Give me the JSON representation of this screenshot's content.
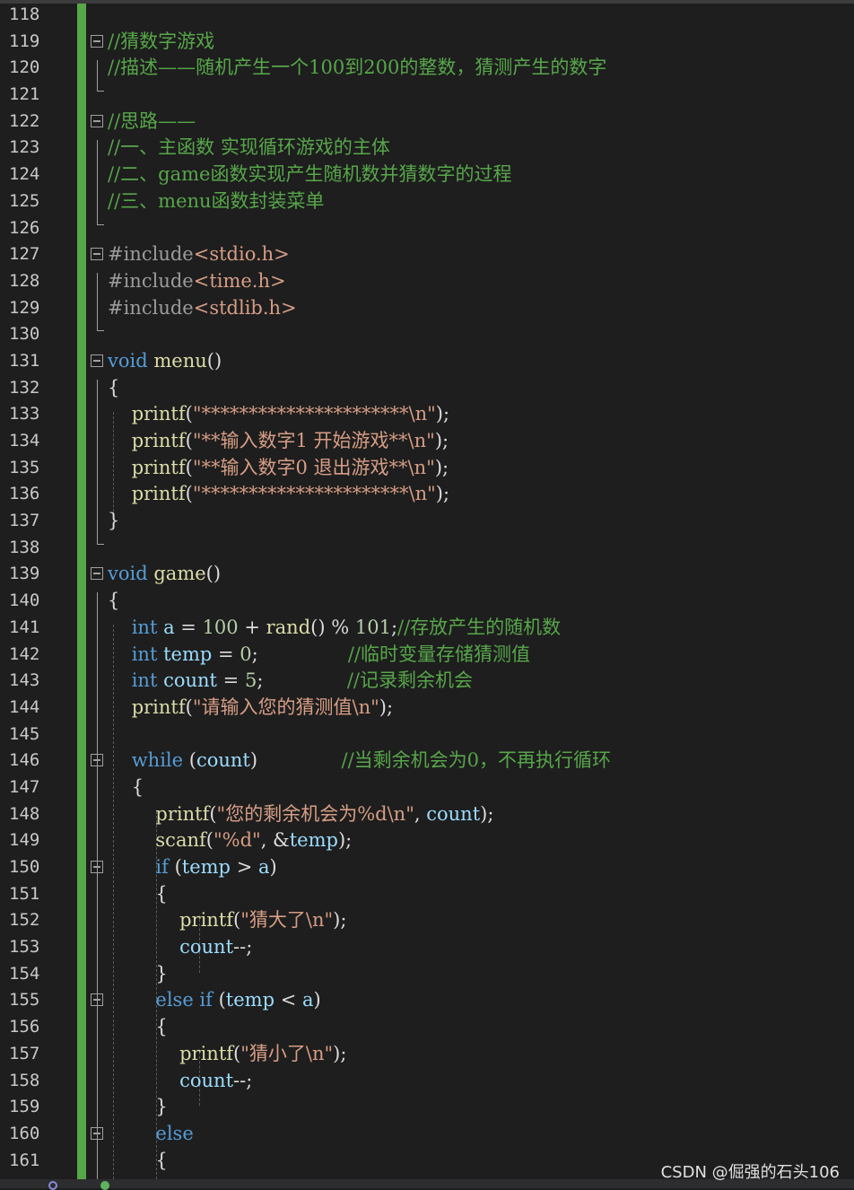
{
  "lines": [
    {
      "n": "118",
      "tokens": []
    },
    {
      "n": "119",
      "tokens": [
        {
          "t": "//猜数字游戏",
          "c": "cm"
        }
      ]
    },
    {
      "n": "120",
      "tokens": [
        {
          "t": "//描述——随机产生一个100到200的整数，猜测产生的数字",
          "c": "cm"
        }
      ]
    },
    {
      "n": "121",
      "tokens": []
    },
    {
      "n": "122",
      "tokens": [
        {
          "t": "//思路——",
          "c": "cm"
        }
      ]
    },
    {
      "n": "123",
      "tokens": [
        {
          "t": "//一、主函数 实现循环游戏的主体",
          "c": "cm"
        }
      ]
    },
    {
      "n": "124",
      "tokens": [
        {
          "t": "//二、game函数实现产生随机数并猜数字的过程",
          "c": "cm"
        }
      ]
    },
    {
      "n": "125",
      "tokens": [
        {
          "t": "//三、menu函数封装菜单",
          "c": "cm"
        }
      ]
    },
    {
      "n": "126",
      "tokens": []
    },
    {
      "n": "127",
      "tokens": [
        {
          "t": "#include",
          "c": "pp"
        },
        {
          "t": "<stdio.h>",
          "c": "st"
        }
      ]
    },
    {
      "n": "128",
      "tokens": [
        {
          "t": "#include",
          "c": "pp"
        },
        {
          "t": "<time.h>",
          "c": "st"
        }
      ]
    },
    {
      "n": "129",
      "tokens": [
        {
          "t": "#include",
          "c": "pp"
        },
        {
          "t": "<stdlib.h>",
          "c": "st"
        }
      ]
    },
    {
      "n": "130",
      "tokens": []
    },
    {
      "n": "131",
      "tokens": [
        {
          "t": "void",
          "c": "kw"
        },
        {
          "t": " ",
          "c": "pl"
        },
        {
          "t": "menu",
          "c": "fn"
        },
        {
          "t": "()",
          "c": "pl"
        }
      ]
    },
    {
      "n": "132",
      "tokens": [
        {
          "t": "{",
          "c": "pl"
        }
      ]
    },
    {
      "n": "133",
      "tokens": [
        {
          "t": "    ",
          "c": "pl"
        },
        {
          "t": "printf",
          "c": "fn"
        },
        {
          "t": "(",
          "c": "pl"
        },
        {
          "t": "\"**********************\\n\"",
          "c": "st"
        },
        {
          "t": ");",
          "c": "pl"
        }
      ]
    },
    {
      "n": "134",
      "tokens": [
        {
          "t": "    ",
          "c": "pl"
        },
        {
          "t": "printf",
          "c": "fn"
        },
        {
          "t": "(",
          "c": "pl"
        },
        {
          "t": "\"**输入数字1 开始游戏**\\n\"",
          "c": "st"
        },
        {
          "t": ");",
          "c": "pl"
        }
      ]
    },
    {
      "n": "135",
      "tokens": [
        {
          "t": "    ",
          "c": "pl"
        },
        {
          "t": "printf",
          "c": "fn"
        },
        {
          "t": "(",
          "c": "pl"
        },
        {
          "t": "\"**输入数字0 退出游戏**\\n\"",
          "c": "st"
        },
        {
          "t": ");",
          "c": "pl"
        }
      ]
    },
    {
      "n": "136",
      "tokens": [
        {
          "t": "    ",
          "c": "pl"
        },
        {
          "t": "printf",
          "c": "fn"
        },
        {
          "t": "(",
          "c": "pl"
        },
        {
          "t": "\"**********************\\n\"",
          "c": "st"
        },
        {
          "t": ");",
          "c": "pl"
        }
      ]
    },
    {
      "n": "137",
      "tokens": [
        {
          "t": "}",
          "c": "pl"
        }
      ]
    },
    {
      "n": "138",
      "tokens": []
    },
    {
      "n": "139",
      "tokens": [
        {
          "t": "void",
          "c": "kw"
        },
        {
          "t": " ",
          "c": "pl"
        },
        {
          "t": "game",
          "c": "fn"
        },
        {
          "t": "()",
          "c": "pl"
        }
      ]
    },
    {
      "n": "140",
      "tokens": [
        {
          "t": "{",
          "c": "pl"
        }
      ]
    },
    {
      "n": "141",
      "tokens": [
        {
          "t": "    ",
          "c": "pl"
        },
        {
          "t": "int",
          "c": "kw"
        },
        {
          "t": " ",
          "c": "pl"
        },
        {
          "t": "a",
          "c": "id"
        },
        {
          "t": " = ",
          "c": "pl"
        },
        {
          "t": "100",
          "c": "nm"
        },
        {
          "t": " + ",
          "c": "pl"
        },
        {
          "t": "rand",
          "c": "fn"
        },
        {
          "t": "() % ",
          "c": "pl"
        },
        {
          "t": "101",
          "c": "nm"
        },
        {
          "t": ";",
          "c": "pl"
        },
        {
          "t": "//存放产生的随机数",
          "c": "cm"
        }
      ]
    },
    {
      "n": "142",
      "tokens": [
        {
          "t": "    ",
          "c": "pl"
        },
        {
          "t": "int",
          "c": "kw"
        },
        {
          "t": " ",
          "c": "pl"
        },
        {
          "t": "temp",
          "c": "id"
        },
        {
          "t": " = ",
          "c": "pl"
        },
        {
          "t": "0",
          "c": "nm"
        },
        {
          "t": ";               ",
          "c": "pl"
        },
        {
          "t": "//临时变量存储猜测值",
          "c": "cm"
        }
      ]
    },
    {
      "n": "143",
      "tokens": [
        {
          "t": "    ",
          "c": "pl"
        },
        {
          "t": "int",
          "c": "kw"
        },
        {
          "t": " ",
          "c": "pl"
        },
        {
          "t": "count",
          "c": "id"
        },
        {
          "t": " = ",
          "c": "pl"
        },
        {
          "t": "5",
          "c": "nm"
        },
        {
          "t": ";              ",
          "c": "pl"
        },
        {
          "t": "//记录剩余机会",
          "c": "cm"
        }
      ]
    },
    {
      "n": "144",
      "tokens": [
        {
          "t": "    ",
          "c": "pl"
        },
        {
          "t": "printf",
          "c": "fn"
        },
        {
          "t": "(",
          "c": "pl"
        },
        {
          "t": "\"请输入您的猜测值\\n\"",
          "c": "st"
        },
        {
          "t": ");",
          "c": "pl"
        }
      ]
    },
    {
      "n": "145",
      "tokens": []
    },
    {
      "n": "146",
      "tokens": [
        {
          "t": "    ",
          "c": "pl"
        },
        {
          "t": "while",
          "c": "kw"
        },
        {
          "t": " (",
          "c": "pl"
        },
        {
          "t": "count",
          "c": "id"
        },
        {
          "t": ")              ",
          "c": "pl"
        },
        {
          "t": "//当剩余机会为0，不再执行循环",
          "c": "cm"
        }
      ]
    },
    {
      "n": "147",
      "tokens": [
        {
          "t": "    {",
          "c": "pl"
        }
      ]
    },
    {
      "n": "148",
      "tokens": [
        {
          "t": "        ",
          "c": "pl"
        },
        {
          "t": "printf",
          "c": "fn"
        },
        {
          "t": "(",
          "c": "pl"
        },
        {
          "t": "\"您的剩余机会为%d\\n\"",
          "c": "st"
        },
        {
          "t": ", ",
          "c": "pl"
        },
        {
          "t": "count",
          "c": "id"
        },
        {
          "t": ");",
          "c": "pl"
        }
      ]
    },
    {
      "n": "149",
      "tokens": [
        {
          "t": "        ",
          "c": "pl"
        },
        {
          "t": "scanf",
          "c": "fn"
        },
        {
          "t": "(",
          "c": "pl"
        },
        {
          "t": "\"%d\"",
          "c": "st"
        },
        {
          "t": ", &",
          "c": "pl"
        },
        {
          "t": "temp",
          "c": "id"
        },
        {
          "t": ");",
          "c": "pl"
        }
      ]
    },
    {
      "n": "150",
      "tokens": [
        {
          "t": "        ",
          "c": "pl"
        },
        {
          "t": "if",
          "c": "kw"
        },
        {
          "t": " (",
          "c": "pl"
        },
        {
          "t": "temp",
          "c": "id"
        },
        {
          "t": " > ",
          "c": "pl"
        },
        {
          "t": "a",
          "c": "id"
        },
        {
          "t": ")",
          "c": "pl"
        }
      ]
    },
    {
      "n": "151",
      "tokens": [
        {
          "t": "        {",
          "c": "pl"
        }
      ]
    },
    {
      "n": "152",
      "tokens": [
        {
          "t": "            ",
          "c": "pl"
        },
        {
          "t": "printf",
          "c": "fn"
        },
        {
          "t": "(",
          "c": "pl"
        },
        {
          "t": "\"猜大了\\n\"",
          "c": "st"
        },
        {
          "t": ");",
          "c": "pl"
        }
      ]
    },
    {
      "n": "153",
      "tokens": [
        {
          "t": "            ",
          "c": "pl"
        },
        {
          "t": "count",
          "c": "id"
        },
        {
          "t": "--;",
          "c": "pl"
        }
      ]
    },
    {
      "n": "154",
      "tokens": [
        {
          "t": "        }",
          "c": "pl"
        }
      ]
    },
    {
      "n": "155",
      "tokens": [
        {
          "t": "        ",
          "c": "pl"
        },
        {
          "t": "else if",
          "c": "kw"
        },
        {
          "t": " (",
          "c": "pl"
        },
        {
          "t": "temp",
          "c": "id"
        },
        {
          "t": " < ",
          "c": "pl"
        },
        {
          "t": "a",
          "c": "id"
        },
        {
          "t": ")",
          "c": "pl"
        }
      ]
    },
    {
      "n": "156",
      "tokens": [
        {
          "t": "        {",
          "c": "pl"
        }
      ]
    },
    {
      "n": "157",
      "tokens": [
        {
          "t": "            ",
          "c": "pl"
        },
        {
          "t": "printf",
          "c": "fn"
        },
        {
          "t": "(",
          "c": "pl"
        },
        {
          "t": "\"猜小了\\n\"",
          "c": "st"
        },
        {
          "t": ");",
          "c": "pl"
        }
      ]
    },
    {
      "n": "158",
      "tokens": [
        {
          "t": "            ",
          "c": "pl"
        },
        {
          "t": "count",
          "c": "id"
        },
        {
          "t": "--;",
          "c": "pl"
        }
      ]
    },
    {
      "n": "159",
      "tokens": [
        {
          "t": "        }",
          "c": "pl"
        }
      ]
    },
    {
      "n": "160",
      "tokens": [
        {
          "t": "        ",
          "c": "pl"
        },
        {
          "t": "else",
          "c": "kw"
        }
      ]
    },
    {
      "n": "161",
      "tokens": [
        {
          "t": "        {",
          "c": "pl"
        }
      ]
    }
  ],
  "watermark": "CSDN @倔强的石头106",
  "colors": {
    "background": "#1e1e1e",
    "comment": "#57a64a",
    "keyword": "#569cd6",
    "string": "#d69d85",
    "identifier": "#9cdcfe",
    "function": "#dcdcaa",
    "change_bar": "#57a64a"
  }
}
